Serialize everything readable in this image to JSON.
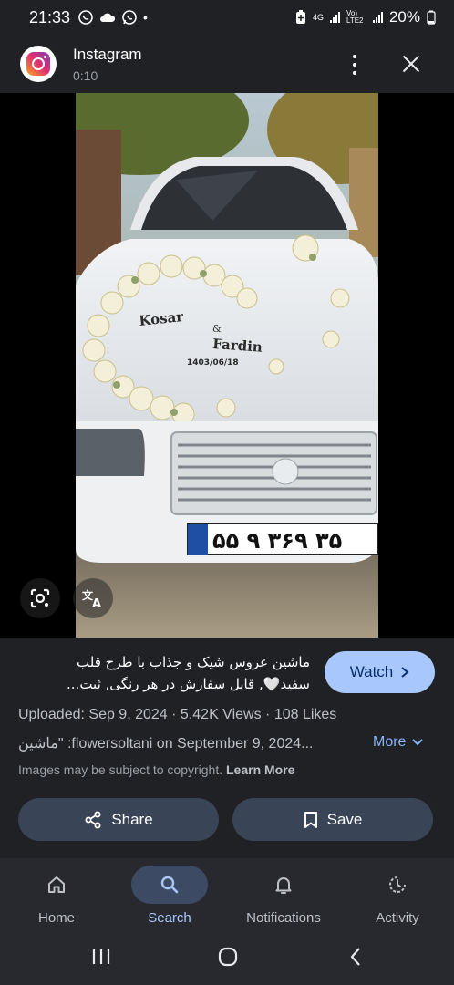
{
  "status_bar": {
    "time": "21:33",
    "network": "4G",
    "volte": "Vo) LTE2",
    "battery": "20%"
  },
  "header": {
    "app_name": "Instagram",
    "duration": "0:10"
  },
  "result": {
    "caption_line1": "ماشین عروس شیک و جذاب با طرح قلب",
    "caption_line2": "سفید🤍, قابل سفارش در هر رنگی, ثبت...",
    "watch_label": "Watch",
    "uploaded": "Uploaded: Sep 9, 2024",
    "views": "5.42K Views",
    "likes": "108 Likes",
    "source_text": "ماشین\" :flowersoltani on September 9, 2024...",
    "more_label": "More",
    "copyright_text": "Images may be subject to copyright.",
    "learn_more": "Learn More"
  },
  "photo": {
    "plate_text": "۵۵ ۹ ۳۶۹ ۳۵",
    "name1": "Kosar",
    "amp": "&",
    "name2": "Fardin",
    "date": "1403/06/18"
  },
  "actions": {
    "share_label": "Share",
    "save_label": "Save"
  },
  "nav": {
    "items": [
      {
        "label": "Home",
        "icon": "home-icon"
      },
      {
        "label": "Search",
        "icon": "search-icon",
        "active": true
      },
      {
        "label": "Notifications",
        "icon": "bell-icon"
      },
      {
        "label": "Activity",
        "icon": "activity-icon"
      }
    ]
  },
  "colors": {
    "background": "#1f2125",
    "accent": "#a8c7fa",
    "button_bg": "#394457",
    "nav_bg": "#27292e"
  }
}
